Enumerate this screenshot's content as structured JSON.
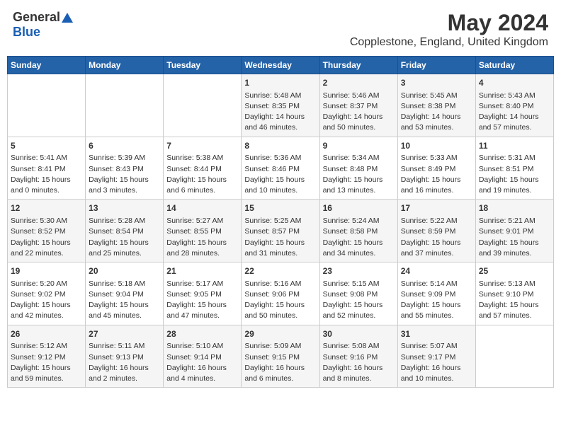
{
  "header": {
    "logo_general": "General",
    "logo_blue": "Blue",
    "title": "May 2024",
    "location": "Copplestone, England, United Kingdom"
  },
  "days_of_week": [
    "Sunday",
    "Monday",
    "Tuesday",
    "Wednesday",
    "Thursday",
    "Friday",
    "Saturday"
  ],
  "weeks": [
    [
      {
        "day": "",
        "info": ""
      },
      {
        "day": "",
        "info": ""
      },
      {
        "day": "",
        "info": ""
      },
      {
        "day": "1",
        "info": "Sunrise: 5:48 AM\nSunset: 8:35 PM\nDaylight: 14 hours\nand 46 minutes."
      },
      {
        "day": "2",
        "info": "Sunrise: 5:46 AM\nSunset: 8:37 PM\nDaylight: 14 hours\nand 50 minutes."
      },
      {
        "day": "3",
        "info": "Sunrise: 5:45 AM\nSunset: 8:38 PM\nDaylight: 14 hours\nand 53 minutes."
      },
      {
        "day": "4",
        "info": "Sunrise: 5:43 AM\nSunset: 8:40 PM\nDaylight: 14 hours\nand 57 minutes."
      }
    ],
    [
      {
        "day": "5",
        "info": "Sunrise: 5:41 AM\nSunset: 8:41 PM\nDaylight: 15 hours\nand 0 minutes."
      },
      {
        "day": "6",
        "info": "Sunrise: 5:39 AM\nSunset: 8:43 PM\nDaylight: 15 hours\nand 3 minutes."
      },
      {
        "day": "7",
        "info": "Sunrise: 5:38 AM\nSunset: 8:44 PM\nDaylight: 15 hours\nand 6 minutes."
      },
      {
        "day": "8",
        "info": "Sunrise: 5:36 AM\nSunset: 8:46 PM\nDaylight: 15 hours\nand 10 minutes."
      },
      {
        "day": "9",
        "info": "Sunrise: 5:34 AM\nSunset: 8:48 PM\nDaylight: 15 hours\nand 13 minutes."
      },
      {
        "day": "10",
        "info": "Sunrise: 5:33 AM\nSunset: 8:49 PM\nDaylight: 15 hours\nand 16 minutes."
      },
      {
        "day": "11",
        "info": "Sunrise: 5:31 AM\nSunset: 8:51 PM\nDaylight: 15 hours\nand 19 minutes."
      }
    ],
    [
      {
        "day": "12",
        "info": "Sunrise: 5:30 AM\nSunset: 8:52 PM\nDaylight: 15 hours\nand 22 minutes."
      },
      {
        "day": "13",
        "info": "Sunrise: 5:28 AM\nSunset: 8:54 PM\nDaylight: 15 hours\nand 25 minutes."
      },
      {
        "day": "14",
        "info": "Sunrise: 5:27 AM\nSunset: 8:55 PM\nDaylight: 15 hours\nand 28 minutes."
      },
      {
        "day": "15",
        "info": "Sunrise: 5:25 AM\nSunset: 8:57 PM\nDaylight: 15 hours\nand 31 minutes."
      },
      {
        "day": "16",
        "info": "Sunrise: 5:24 AM\nSunset: 8:58 PM\nDaylight: 15 hours\nand 34 minutes."
      },
      {
        "day": "17",
        "info": "Sunrise: 5:22 AM\nSunset: 8:59 PM\nDaylight: 15 hours\nand 37 minutes."
      },
      {
        "day": "18",
        "info": "Sunrise: 5:21 AM\nSunset: 9:01 PM\nDaylight: 15 hours\nand 39 minutes."
      }
    ],
    [
      {
        "day": "19",
        "info": "Sunrise: 5:20 AM\nSunset: 9:02 PM\nDaylight: 15 hours\nand 42 minutes."
      },
      {
        "day": "20",
        "info": "Sunrise: 5:18 AM\nSunset: 9:04 PM\nDaylight: 15 hours\nand 45 minutes."
      },
      {
        "day": "21",
        "info": "Sunrise: 5:17 AM\nSunset: 9:05 PM\nDaylight: 15 hours\nand 47 minutes."
      },
      {
        "day": "22",
        "info": "Sunrise: 5:16 AM\nSunset: 9:06 PM\nDaylight: 15 hours\nand 50 minutes."
      },
      {
        "day": "23",
        "info": "Sunrise: 5:15 AM\nSunset: 9:08 PM\nDaylight: 15 hours\nand 52 minutes."
      },
      {
        "day": "24",
        "info": "Sunrise: 5:14 AM\nSunset: 9:09 PM\nDaylight: 15 hours\nand 55 minutes."
      },
      {
        "day": "25",
        "info": "Sunrise: 5:13 AM\nSunset: 9:10 PM\nDaylight: 15 hours\nand 57 minutes."
      }
    ],
    [
      {
        "day": "26",
        "info": "Sunrise: 5:12 AM\nSunset: 9:12 PM\nDaylight: 15 hours\nand 59 minutes."
      },
      {
        "day": "27",
        "info": "Sunrise: 5:11 AM\nSunset: 9:13 PM\nDaylight: 16 hours\nand 2 minutes."
      },
      {
        "day": "28",
        "info": "Sunrise: 5:10 AM\nSunset: 9:14 PM\nDaylight: 16 hours\nand 4 minutes."
      },
      {
        "day": "29",
        "info": "Sunrise: 5:09 AM\nSunset: 9:15 PM\nDaylight: 16 hours\nand 6 minutes."
      },
      {
        "day": "30",
        "info": "Sunrise: 5:08 AM\nSunset: 9:16 PM\nDaylight: 16 hours\nand 8 minutes."
      },
      {
        "day": "31",
        "info": "Sunrise: 5:07 AM\nSunset: 9:17 PM\nDaylight: 16 hours\nand 10 minutes."
      },
      {
        "day": "",
        "info": ""
      }
    ]
  ]
}
